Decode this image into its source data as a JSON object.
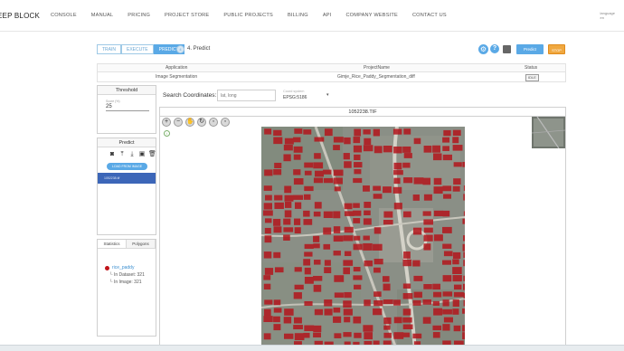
{
  "nav": {
    "brand": "EEP BLOCK",
    "items": [
      "CONSOLE",
      "MANUAL",
      "PRICING",
      "PROJECT STORE",
      "PUBLIC PROJECTS",
      "BILLING",
      "API",
      "COMPANY WEBSITE",
      "CONTACT US"
    ],
    "language_label": "language",
    "language_value": "en"
  },
  "steps": {
    "items": [
      "TRAIN",
      "EXECUTE",
      "PREDICT"
    ],
    "active": "PREDICT",
    "number": "4",
    "current_label": "4. Predict",
    "predict_button": "Predict",
    "orange_button": "STOP"
  },
  "project_table": {
    "headers": [
      "Application",
      "ProjectName",
      "Status"
    ],
    "row": {
      "application": "Image Segmentation",
      "project_name": "Gimje_Rice_Paddy_Segmentation_diff",
      "status": "IDLE"
    }
  },
  "threshold": {
    "title": "Threshold",
    "field_label": "Score (%)",
    "value": "25"
  },
  "predict_panel": {
    "title": "Predict",
    "load_button": "LOAD FROM IMAGE",
    "file": "1052238.tif"
  },
  "stats": {
    "tabs": [
      "Statistics",
      "Polygons"
    ],
    "class_name": "rice_paddy",
    "class_color": "#c0141a",
    "in_dataset": "In Dataset: 321",
    "in_image": "In Image: 321"
  },
  "search": {
    "label": "Search Coordinates:",
    "placeholder": "lat, long",
    "coord_label": "Coord system",
    "coord_value": "EPSG:5186"
  },
  "viewer": {
    "title": "1052238.TIF",
    "tools": [
      "zoom-in",
      "zoom-out",
      "hand",
      "rotate",
      "fit",
      "reset"
    ]
  },
  "colors": {
    "accent": "#5aa9e6",
    "mask": "#c0141a",
    "orange": "#f0a840"
  }
}
